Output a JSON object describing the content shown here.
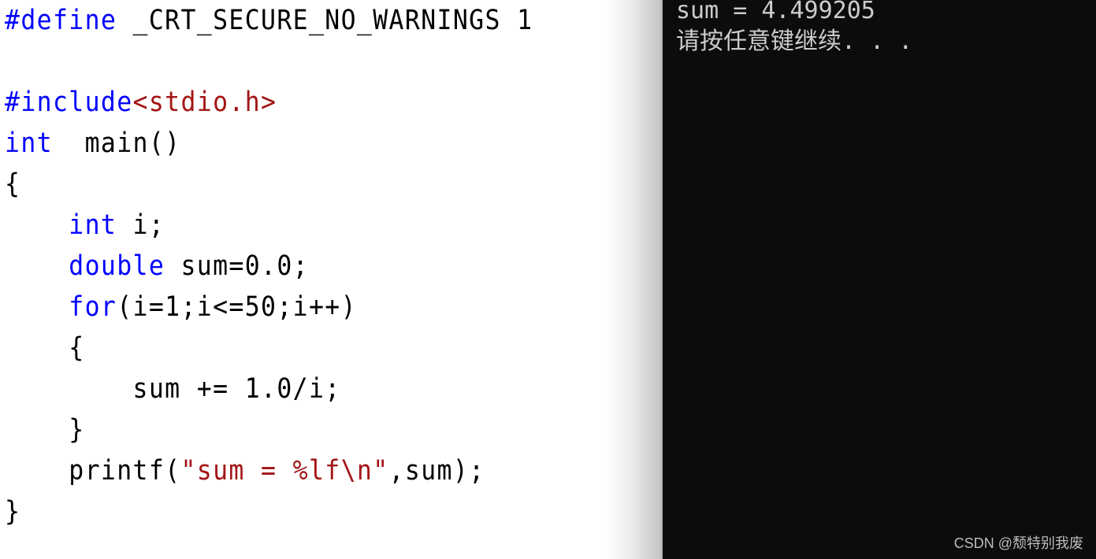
{
  "editor": {
    "lines": [
      {
        "tokens": [
          {
            "t": "#define",
            "c": "pp"
          },
          {
            "t": " _CRT_SECURE_NO_WARNINGS 1",
            "c": ""
          }
        ]
      },
      {
        "tokens": []
      },
      {
        "tokens": [
          {
            "t": "#include",
            "c": "pp"
          },
          {
            "t": "<stdio.h>",
            "c": "str"
          }
        ]
      },
      {
        "tokens": [
          {
            "t": "int",
            "c": "kw"
          },
          {
            "t": "  main()",
            "c": ""
          }
        ]
      },
      {
        "tokens": [
          {
            "t": "{",
            "c": ""
          }
        ]
      },
      {
        "tokens": [
          {
            "t": "    ",
            "c": ""
          },
          {
            "t": "int",
            "c": "kw"
          },
          {
            "t": " i;",
            "c": ""
          }
        ]
      },
      {
        "tokens": [
          {
            "t": "    ",
            "c": ""
          },
          {
            "t": "double",
            "c": "kw"
          },
          {
            "t": " sum=0.0;",
            "c": ""
          }
        ]
      },
      {
        "tokens": [
          {
            "t": "    ",
            "c": ""
          },
          {
            "t": "for",
            "c": "kw"
          },
          {
            "t": "(i=1;i<=50;i++)",
            "c": ""
          }
        ]
      },
      {
        "tokens": [
          {
            "t": "    {",
            "c": ""
          }
        ]
      },
      {
        "tokens": [
          {
            "t": "        sum += 1.0/i;",
            "c": ""
          }
        ]
      },
      {
        "tokens": [
          {
            "t": "    }",
            "c": ""
          }
        ]
      },
      {
        "tokens": [
          {
            "t": "    printf(",
            "c": ""
          },
          {
            "t": "\"sum = %lf\\n\"",
            "c": "str"
          },
          {
            "t": ",sum);",
            "c": ""
          }
        ]
      },
      {
        "tokens": [
          {
            "t": "}",
            "c": ""
          }
        ]
      }
    ]
  },
  "console": {
    "output_line": "sum = 4.499205",
    "prompt_line": "请按任意键继续. . ."
  },
  "watermark": "CSDN @颓特别我废",
  "colors": {
    "keyword": "#0000ff",
    "string": "#a31515",
    "console_bg": "#0c0c0c",
    "console_text": "#cccccc"
  }
}
